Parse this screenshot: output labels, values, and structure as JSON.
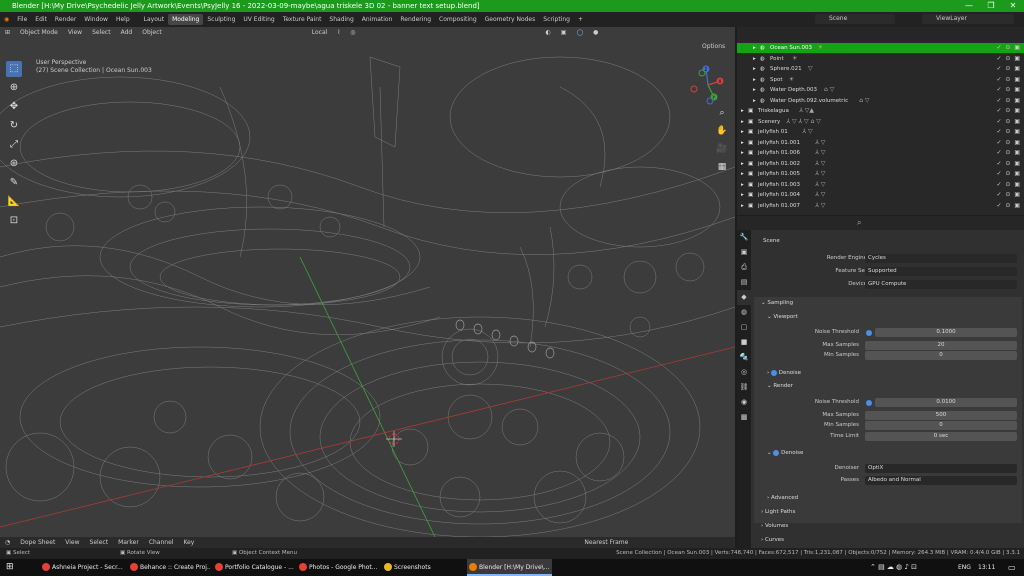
{
  "window": {
    "title": "Blender [H:\\My Drive\\Psychedelic Jelly Artwork\\Events\\PsyJelly 16 - 2022-03-09-maybe\\agua triskele 3D 02 - banner text setup.blend]",
    "controls": [
      "—",
      "❐",
      "✕"
    ]
  },
  "topbar": {
    "menus": [
      "File",
      "Edit",
      "Render",
      "Window",
      "Help"
    ],
    "workspaces": [
      "Layout",
      "Modeling",
      "Sculpting",
      "UV Editing",
      "Texture Paint",
      "Shading",
      "Animation",
      "Rendering",
      "Compositing",
      "Geometry Nodes",
      "Scripting"
    ],
    "active_workspace": "Modeling",
    "add_tab": "+",
    "scene": "Scene",
    "view_layer": "ViewLayer"
  },
  "viewport": {
    "mode": "Object Mode",
    "menus": [
      "View",
      "Select",
      "Add",
      "Object"
    ],
    "orientation": "Local",
    "options": "Options",
    "info_line1": "User Perspective",
    "info_line2": "(27) Scene Collection | Ocean Sun.003",
    "gizmo_labels": [
      "X",
      "Y",
      "Z"
    ]
  },
  "outliner": {
    "rows": [
      {
        "name": "Ocean Sun.003",
        "indent": 2,
        "selected": true,
        "ext": "☀"
      },
      {
        "name": "Point",
        "indent": 2,
        "selected": false,
        "ext": "☀"
      },
      {
        "name": "Sphere.021",
        "indent": 2,
        "selected": false,
        "ext": "▽"
      },
      {
        "name": "Spot",
        "indent": 2,
        "selected": false,
        "ext": "☀"
      },
      {
        "name": "Water Depth.003",
        "indent": 2,
        "selected": false,
        "ext": "⌂ ▽"
      },
      {
        "name": "Water Depth.092.volumetric",
        "indent": 2,
        "selected": false,
        "ext": "⌂ ▽"
      },
      {
        "name": "Triskelagua",
        "indent": 1,
        "selected": false,
        "ext": "⅄ ▽▲"
      },
      {
        "name": "Scenery",
        "indent": 1,
        "selected": false,
        "ext": "⅄ ▽ ⅄ ▽ ⌂ ▽"
      },
      {
        "name": "jellyfish 01",
        "indent": 1,
        "selected": false,
        "ext": "⅄ ▽"
      },
      {
        "name": "jellyfish 01.001",
        "indent": 1,
        "selected": false,
        "ext": "⅄ ▽"
      },
      {
        "name": "jellyfish 01.006",
        "indent": 1,
        "selected": false,
        "ext": "⅄ ▽"
      },
      {
        "name": "jellyfish 01.002",
        "indent": 1,
        "selected": false,
        "ext": "⅄ ▽"
      },
      {
        "name": "jellyfish 01.005",
        "indent": 1,
        "selected": false,
        "ext": "⅄ ▽"
      },
      {
        "name": "jellyfish 01.003",
        "indent": 1,
        "selected": false,
        "ext": "⅄ ▽"
      },
      {
        "name": "jellyfish 01.004",
        "indent": 1,
        "selected": false,
        "ext": "⅄ ▽"
      },
      {
        "name": "jellyfish 01.007",
        "indent": 1,
        "selected": false,
        "ext": "⅄ ▽"
      }
    ],
    "visibility_icons": "✓ ⊙ ▣"
  },
  "properties": {
    "context": "Scene",
    "render_engine_label": "Render Engine",
    "render_engine": "Cycles",
    "feature_set_label": "Feature Set",
    "feature_set": "Supported",
    "device_label": "Device",
    "device": "GPU Compute",
    "sampling": "Sampling",
    "viewport": "Viewport",
    "noise_threshold_label": "Noise Threshold",
    "viewport_noise_threshold": "0.1000",
    "max_samples_label": "Max Samples",
    "viewport_max_samples": "20",
    "min_samples_label": "Min Samples",
    "viewport_min_samples": "0",
    "denoise": "Denoise",
    "render": "Render",
    "render_noise_threshold": "0.0100",
    "render_max_samples": "500",
    "render_min_samples": "0",
    "time_limit_label": "Time Limit",
    "time_limit": "0 sec",
    "denoiser_label": "Denoiser",
    "denoiser": "OptiX",
    "passes_label": "Passes",
    "passes": "Albedo and Normal",
    "advanced": "Advanced",
    "light_paths": "Light Paths",
    "volumes": "Volumes",
    "curves": "Curves"
  },
  "timeline": {
    "editor": "Dope Sheet",
    "menus": [
      "View",
      "Select",
      "Marker",
      "Channel",
      "Key"
    ],
    "snap": "Nearest Frame"
  },
  "statusbar": {
    "select": "Select",
    "rotate": "Rotate View",
    "context_menu": "Object Context Menu",
    "stats": "Scene Collection | Ocean Sun.003 | Verts:748,740 | Faces:672,517 | Tris:1,231,087 | Objects:0/752 | Memory: 264.3 MiB | VRAM: 0.4/4.0 GiB | 3.3.1"
  },
  "taskbar": {
    "items": [
      {
        "label": "Ashneia Project - Secr...",
        "color": "#e34133"
      },
      {
        "label": "Behance :: Create Proj...",
        "color": "#e34133"
      },
      {
        "label": "Portfolio Catalogue - ...",
        "color": "#e34133"
      },
      {
        "label": "Photos - Google Phot...",
        "color": "#e34133"
      },
      {
        "label": "Screenshots",
        "color": "#e8b828"
      },
      {
        "label": "Blender [H:\\My Drive\\...",
        "color": "#e87d0d"
      }
    ],
    "lang": "ENG",
    "time": "13:11"
  },
  "colors": {
    "title_green": "#1b9a1b",
    "selection_green": "#14a314",
    "accent_blue": "#4772b3"
  }
}
